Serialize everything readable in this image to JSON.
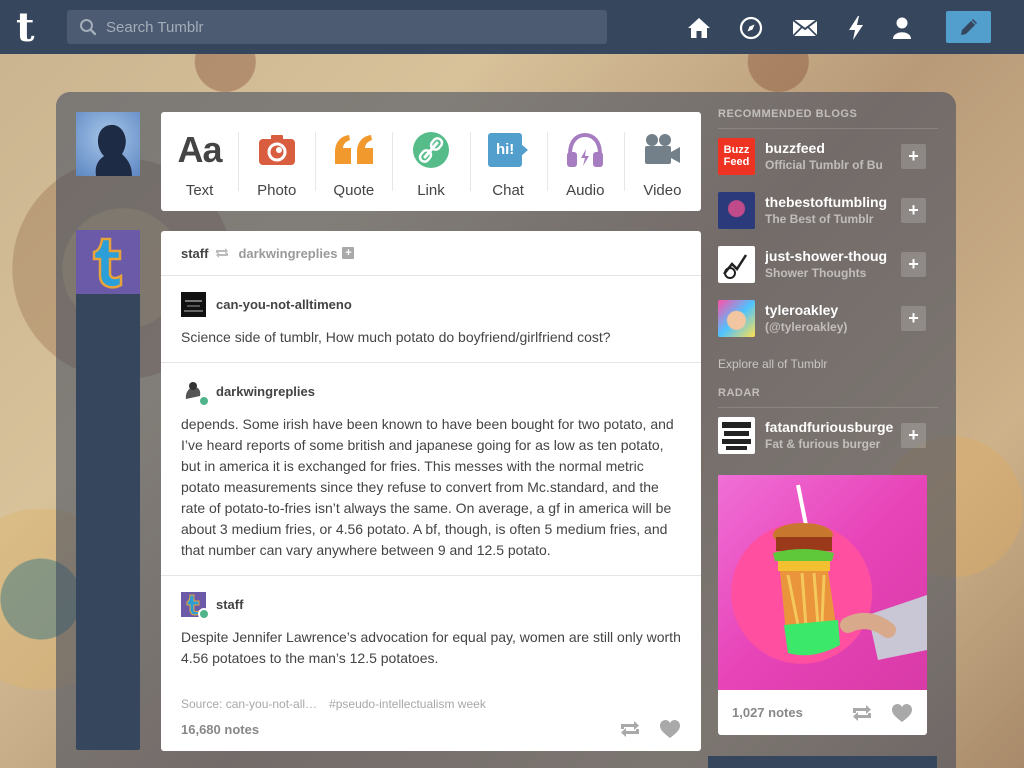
{
  "topbar": {
    "logo": "t",
    "search_placeholder": "Search Tumblr",
    "icons": [
      "home-icon",
      "explore-compass-icon",
      "inbox-mail-icon",
      "activity-lightning-icon",
      "account-person-icon",
      "compose-pencil-icon"
    ]
  },
  "post_types": [
    {
      "label": "Text",
      "icon": "text-icon",
      "glyph": "Aa",
      "color": "#444444"
    },
    {
      "label": "Photo",
      "icon": "camera-icon",
      "color": "#d95e40"
    },
    {
      "label": "Quote",
      "icon": "quote-icon",
      "glyph": "66",
      "color": "#f2992e"
    },
    {
      "label": "Link",
      "icon": "link-icon",
      "color": "#56bc8a"
    },
    {
      "label": "Chat",
      "icon": "chat-icon",
      "glyph": "hi!",
      "color": "#529ecc"
    },
    {
      "label": "Audio",
      "icon": "headphones-icon",
      "color": "#a77dc2"
    },
    {
      "label": "Video",
      "icon": "video-camera-icon",
      "color": "#748089"
    }
  ],
  "post": {
    "author": "staff",
    "reblogged_from": "darkwingreplies",
    "trail": [
      {
        "name": "can-you-not-alltimeno",
        "text": "Science side of tumblr, How much potato do boyfriend/girlfriend cost?"
      },
      {
        "name": "darkwingreplies",
        "text": "depends. Some irish have been known to have been bought for two potato, and I’ve heard reports of some british and japanese going for as low as ten potato, but in america it is exchanged for fries. This messes with the normal metric potato measurements since they refuse to convert from Mc.standard, and the rate of potato-to-fries isn’t always the same. On average, a gf in america will be about 3 medium fries, or 4.56 potato. A bf, though, is often 5 medium fries, and that number can vary anywhere between 9 and 12.5 potato."
      },
      {
        "name": "staff",
        "text": "Despite Jennifer Lawrence’s advocation for equal pay, women are still only worth 4.56 potatoes to the man’s 12.5 potatoes."
      }
    ],
    "source": "Source: can-you-not-all…",
    "tags": "#pseudo-intellectualism week",
    "notes": "16,680 notes"
  },
  "sidebar": {
    "recommended_title": "RECOMMENDED BLOGS",
    "blogs": [
      {
        "name": "buzzfeed",
        "subtitle": "Official Tumblr of Bu",
        "avatar_text": "Buzz\nFeed",
        "color": "#ee3322"
      },
      {
        "name": "thebestoftumbling",
        "subtitle": "The Best of Tumblr",
        "color": "#3a4a8c"
      },
      {
        "name": "just-shower-thoug",
        "subtitle": "Shower Thoughts",
        "color": "#ffffff"
      },
      {
        "name": "tyleroakley",
        "subtitle": "(@tyleroakley)",
        "color": "#6a4aa8"
      }
    ],
    "explore": "Explore all of Tumblr",
    "radar_title": "RADAR",
    "radar": {
      "name": "fatandfuriousburge",
      "subtitle": "Fat & furious burger",
      "notes": "1,027 notes"
    },
    "follow_label": "+"
  }
}
